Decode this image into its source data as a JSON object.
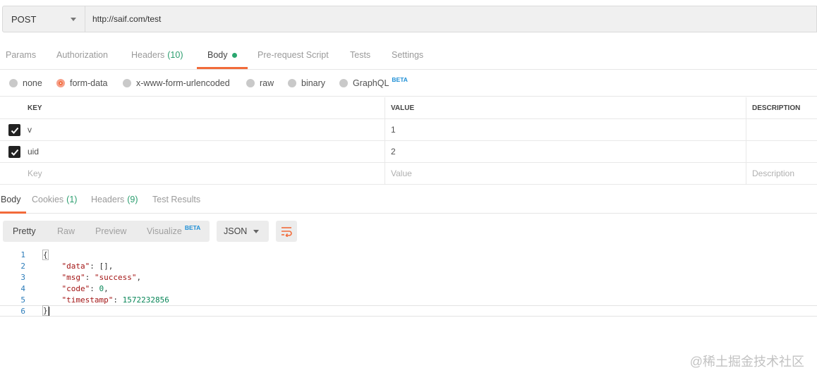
{
  "request": {
    "method": "POST",
    "url": "http://saif.com/test"
  },
  "request_tabs": [
    {
      "label": "Params"
    },
    {
      "label": "Authorization"
    },
    {
      "label": "Headers",
      "count": "(10)"
    },
    {
      "label": "Body",
      "active": true
    },
    {
      "label": "Pre-request Script"
    },
    {
      "label": "Tests"
    },
    {
      "label": "Settings"
    }
  ],
  "body_types": [
    {
      "label": "none"
    },
    {
      "label": "form-data",
      "selected": true
    },
    {
      "label": "x-www-form-urlencoded"
    },
    {
      "label": "raw"
    },
    {
      "label": "binary"
    },
    {
      "label": "GraphQL",
      "badge": "BETA"
    }
  ],
  "kv_table": {
    "headers": {
      "key": "KEY",
      "value": "VALUE",
      "description": "DESCRIPTION"
    },
    "rows": [
      {
        "checked": true,
        "key": "v",
        "value": "1"
      },
      {
        "checked": true,
        "key": "uid",
        "value": "2"
      }
    ],
    "placeholders": {
      "key": "Key",
      "value": "Value",
      "description": "Description"
    }
  },
  "response_tabs": [
    {
      "label": "Body",
      "active": true
    },
    {
      "label": "Cookies",
      "count": "(1)"
    },
    {
      "label": "Headers",
      "count": "(9)"
    },
    {
      "label": "Test Results"
    }
  ],
  "view_modes": [
    {
      "label": "Pretty",
      "active": true
    },
    {
      "label": "Raw"
    },
    {
      "label": "Preview"
    },
    {
      "label": "Visualize",
      "badge": "BETA"
    }
  ],
  "format_select": "JSON",
  "response_lines": [
    {
      "n": "1",
      "text": "{"
    },
    {
      "n": "2",
      "key": "\"data\"",
      "rest": ": [],"
    },
    {
      "n": "3",
      "key": "\"msg\"",
      "sep": ": ",
      "str": "\"success\"",
      "tail": ","
    },
    {
      "n": "4",
      "key": "\"code\"",
      "sep": ": ",
      "num": "0",
      "tail": ","
    },
    {
      "n": "5",
      "key": "\"timestamp\"",
      "sep": ": ",
      "num": "1572232856",
      "tail": ""
    },
    {
      "n": "6",
      "text": "}"
    }
  ],
  "watermark": "@稀土掘金技术社区",
  "colors": {
    "accent": "#f26b3a",
    "count_green": "#2a9d6e",
    "beta_blue": "#1e8fd6"
  }
}
